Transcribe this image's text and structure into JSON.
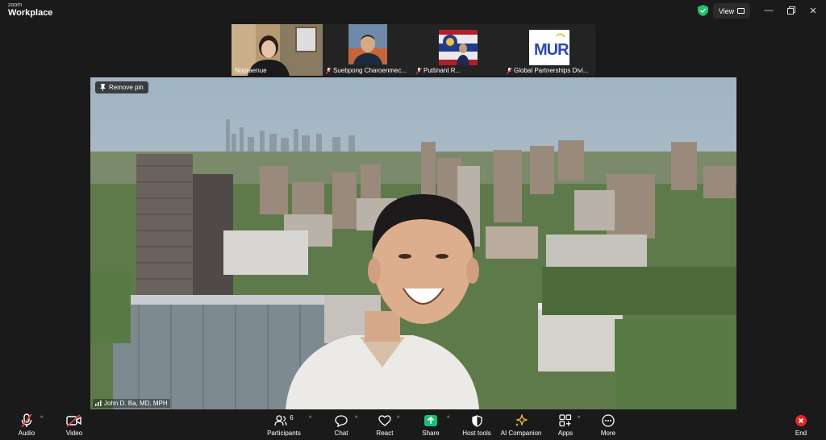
{
  "app": {
    "brand_small": "zoom",
    "brand_big": "Workplace"
  },
  "titlebar": {
    "view_label": "View"
  },
  "participants_strip": [
    {
      "name": "Nopraenue",
      "muted": false
    },
    {
      "name": "Suebpong Charoenmec...",
      "muted": true
    },
    {
      "name": "Puttinant R...",
      "muted": true
    },
    {
      "name": "Global Partnerships Divi...",
      "muted": true
    }
  ],
  "main_video": {
    "remove_pin_label": "Remove pin",
    "speaker_name": "John D. Ba, MD, MPH"
  },
  "logo_text": "MUR",
  "toolbar": {
    "audio": "Audio",
    "video": "Video",
    "participants": "Participants",
    "participants_count": "6",
    "chat": "Chat",
    "react": "React",
    "share": "Share",
    "host_tools": "Host tools",
    "ai_companion": "AI Companion",
    "apps": "Apps",
    "more": "More",
    "end": "End"
  },
  "colors": {
    "share_green": "#16c172",
    "end_red": "#e02828",
    "shield_green": "#1ec26a",
    "mic_red": "#e04545"
  }
}
